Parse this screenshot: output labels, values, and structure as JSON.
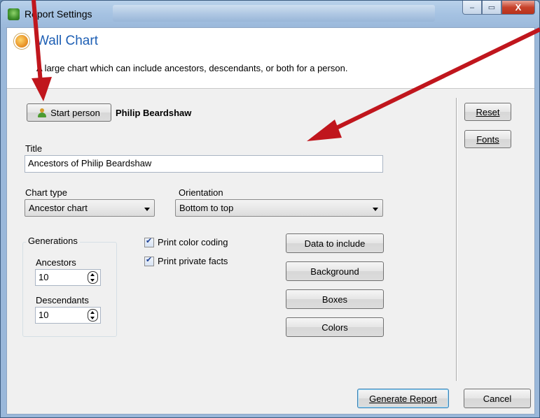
{
  "window": {
    "title": "Report Settings",
    "minimize": "–",
    "maximize": "▭",
    "close": "X"
  },
  "header": {
    "title": "Wall Chart",
    "description": "A large chart which can include ancestors, descendants, or both for a person."
  },
  "start_person": {
    "button_label": "Start person",
    "name": "Philip Beardshaw"
  },
  "title_field": {
    "label": "Title",
    "value": "Ancestors of Philip Beardshaw"
  },
  "chart_type": {
    "label": "Chart type",
    "value": "Ancestor chart"
  },
  "orientation": {
    "label": "Orientation",
    "value": "Bottom to top"
  },
  "generations": {
    "group_label": "Generations",
    "ancestors_label": "Ancestors",
    "ancestors_value": "10",
    "descendants_label": "Descendants",
    "descendants_value": "10"
  },
  "options": {
    "print_color_coding": "Print color coding",
    "print_private_facts": "Print private facts"
  },
  "buttons": {
    "data_to_include": "Data to include",
    "background": "Background",
    "boxes": "Boxes",
    "colors": "Colors",
    "reset": "Reset",
    "fonts": "Fonts",
    "generate": "Generate Report",
    "cancel": "Cancel"
  },
  "annotation_color": "#c0161d"
}
